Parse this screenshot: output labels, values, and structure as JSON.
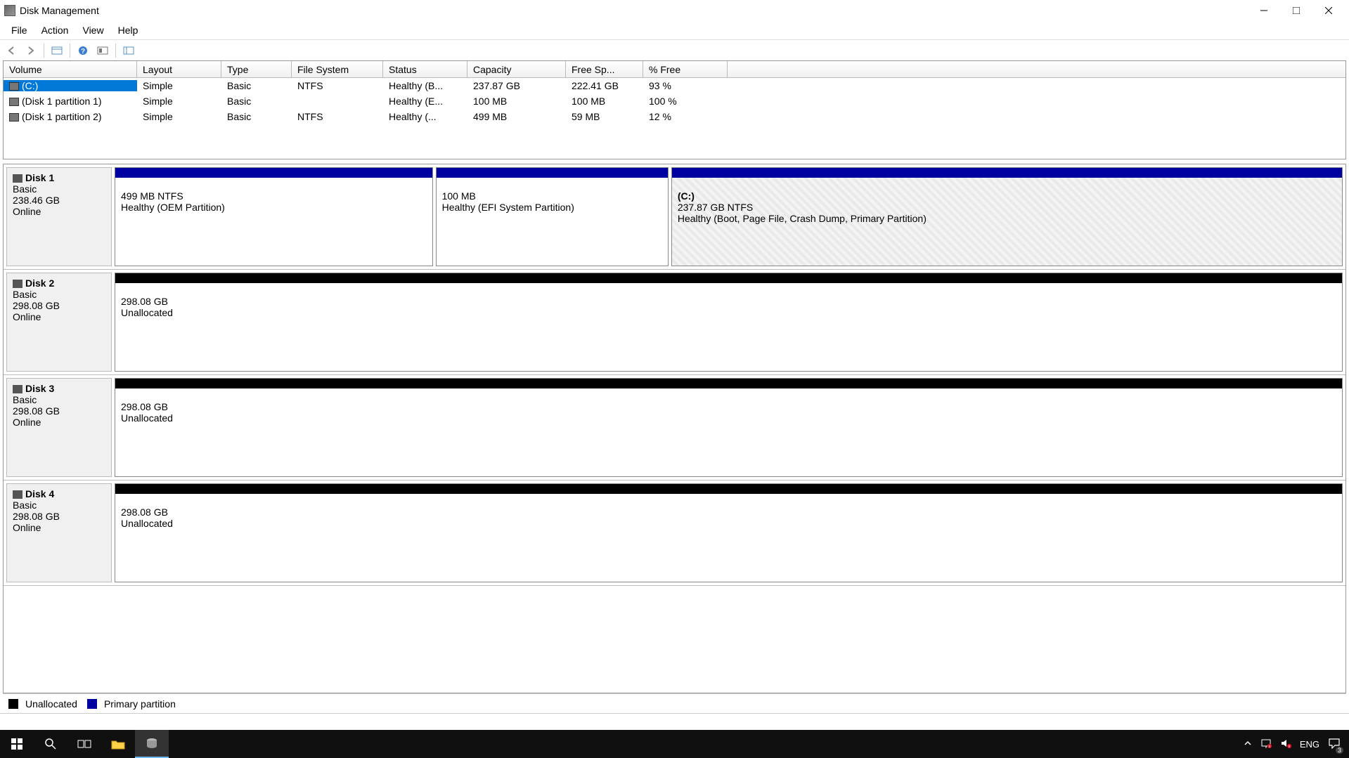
{
  "window": {
    "title": "Disk Management"
  },
  "menu": {
    "items": [
      "File",
      "Action",
      "View",
      "Help"
    ]
  },
  "volume_headers": [
    "Volume",
    "Layout",
    "Type",
    "File System",
    "Status",
    "Capacity",
    "Free Sp...",
    "% Free"
  ],
  "volumes": [
    {
      "name": "(C:)",
      "layout": "Simple",
      "type": "Basic",
      "fs": "NTFS",
      "status": "Healthy (B...",
      "capacity": "237.87 GB",
      "free": "222.41 GB",
      "pct": "93 %",
      "selected": true
    },
    {
      "name": "(Disk 1 partition 1)",
      "layout": "Simple",
      "type": "Basic",
      "fs": "",
      "status": "Healthy (E...",
      "capacity": "100 MB",
      "free": "100 MB",
      "pct": "100 %",
      "selected": false
    },
    {
      "name": "(Disk 1 partition 2)",
      "layout": "Simple",
      "type": "Basic",
      "fs": "NTFS",
      "status": "Healthy (...",
      "capacity": "499 MB",
      "free": "59 MB",
      "pct": "12 %",
      "selected": false
    }
  ],
  "disks": [
    {
      "name": "Disk 1",
      "type": "Basic",
      "size": "238.46 GB",
      "status": "Online",
      "partitions": [
        {
          "title": "",
          "line1": "499 MB NTFS",
          "line2": "Healthy (OEM Partition)",
          "header": "blue",
          "flex": 26,
          "selected": false
        },
        {
          "title": "",
          "line1": "100 MB",
          "line2": "Healthy (EFI System Partition)",
          "header": "blue",
          "flex": 19,
          "selected": false
        },
        {
          "title": "(C:)",
          "line1": "237.87 GB NTFS",
          "line2": "Healthy (Boot, Page File, Crash Dump, Primary Partition)",
          "header": "blue",
          "flex": 55,
          "selected": true
        }
      ]
    },
    {
      "name": "Disk 2",
      "type": "Basic",
      "size": "298.08 GB",
      "status": "Online",
      "partitions": [
        {
          "title": "",
          "line1": "298.08 GB",
          "line2": "Unallocated",
          "header": "black",
          "flex": 100,
          "selected": false
        }
      ]
    },
    {
      "name": "Disk 3",
      "type": "Basic",
      "size": "298.08 GB",
      "status": "Online",
      "partitions": [
        {
          "title": "",
          "line1": "298.08 GB",
          "line2": "Unallocated",
          "header": "black",
          "flex": 100,
          "selected": false
        }
      ]
    },
    {
      "name": "Disk 4",
      "type": "Basic",
      "size": "298.08 GB",
      "status": "Online",
      "partitions": [
        {
          "title": "",
          "line1": "298.08 GB",
          "line2": "Unallocated",
          "header": "black",
          "flex": 100,
          "selected": false
        }
      ]
    }
  ],
  "legend": {
    "unalloc": "Unallocated",
    "primary": "Primary partition"
  },
  "taskbar": {
    "lang": "ENG",
    "notif_count": "3"
  }
}
